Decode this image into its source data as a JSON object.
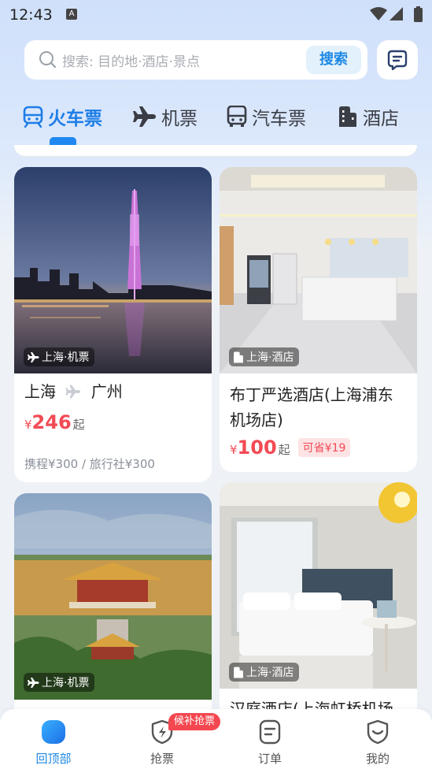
{
  "status_bar": {
    "time": "12:43",
    "a_icon": "A"
  },
  "search": {
    "placeholder": "搜索: 目的地·酒店·景点",
    "button": "搜索"
  },
  "tabs": [
    {
      "label": "火车票",
      "icon": "train-icon",
      "active": true
    },
    {
      "label": "机票",
      "icon": "plane-icon"
    },
    {
      "label": "汽车票",
      "icon": "bus-icon"
    },
    {
      "label": "酒店",
      "icon": "hotel-icon"
    }
  ],
  "cards": [
    {
      "badge": "上海·机票",
      "title_from": "上海",
      "title_to": "广州",
      "currency": "¥",
      "price": "246",
      "suffix": "起",
      "sub": "携程¥300 / 旅行社¥300",
      "image": "guangzhou-tower-night"
    },
    {
      "badge": "上海·酒店",
      "title": "布丁严选酒店(上海浦东机场店)",
      "currency": "¥",
      "price": "100",
      "suffix": "起",
      "save": "可省¥19",
      "image": "hotel-lobby"
    },
    {
      "badge": "上海·机票",
      "image": "forbidden-city"
    },
    {
      "badge": "上海·酒店",
      "title": "汉庭酒店(上海虹桥机场",
      "image": "hotel-room"
    }
  ],
  "bottom_nav": [
    {
      "label": "回顶部",
      "active": true
    },
    {
      "label": "抢票",
      "badge": "候补抢票"
    },
    {
      "label": "订单"
    },
    {
      "label": "我的"
    }
  ],
  "colors": {
    "accent": "#1e88e5",
    "price": "#f24b55"
  }
}
